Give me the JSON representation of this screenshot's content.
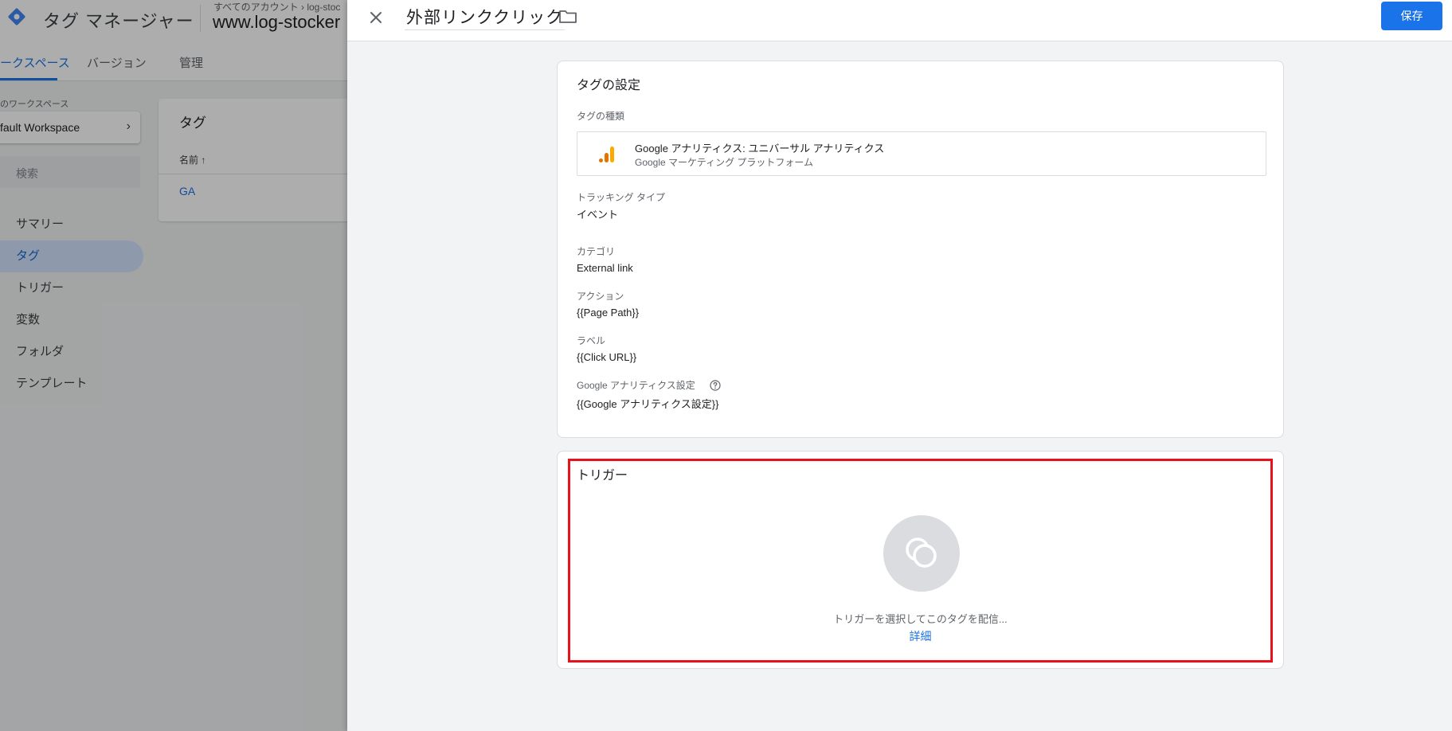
{
  "background": {
    "app_name": "タグ マネージャー",
    "breadcrumb": "すべてのアカウント › log-stoc",
    "container_name": "www.log-stocker",
    "tabs": [
      {
        "label": "ークスペース"
      },
      {
        "label": "バージョン"
      },
      {
        "label": "管理"
      }
    ],
    "workspace_label": "のワークスペース",
    "workspace_name": "fault Workspace",
    "search_placeholder": "検索",
    "nav": [
      {
        "label": "サマリー"
      },
      {
        "label": "タグ"
      },
      {
        "label": "トリガー"
      },
      {
        "label": "変数"
      },
      {
        "label": "フォルダ"
      },
      {
        "label": "テンプレート"
      }
    ],
    "tags_card": {
      "title": "タグ",
      "col_name": "名前 ↑",
      "row": "GA"
    }
  },
  "panel": {
    "title": "外部リンククリック",
    "save_label": "保存",
    "config": {
      "title": "タグの設定",
      "tag_type_label": "タグの種類",
      "tag_type_name": "Google アナリティクス: ユニバーサル アナリティクス",
      "tag_type_sub": "Google マーケティング プラットフォーム",
      "tracking_type_label": "トラッキング タイプ",
      "tracking_type_value": "イベント",
      "category_label": "カテゴリ",
      "category_value": "External link",
      "action_label": "アクション",
      "action_value": "{{Page Path}}",
      "label_label": "ラベル",
      "label_value": "{{Click URL}}",
      "ga_settings_label": "Google アナリティクス設定",
      "ga_settings_value": "{{Google アナリティクス設定}}"
    },
    "trigger": {
      "title": "トリガー",
      "hint": "トリガーを選択してこのタグを配信...",
      "details_link": "詳細"
    }
  },
  "colors": {
    "accent": "#1a73e8",
    "highlight": "#e8121c",
    "analytics_orange": "#f9ab00",
    "analytics_dark_orange": "#e37400"
  }
}
